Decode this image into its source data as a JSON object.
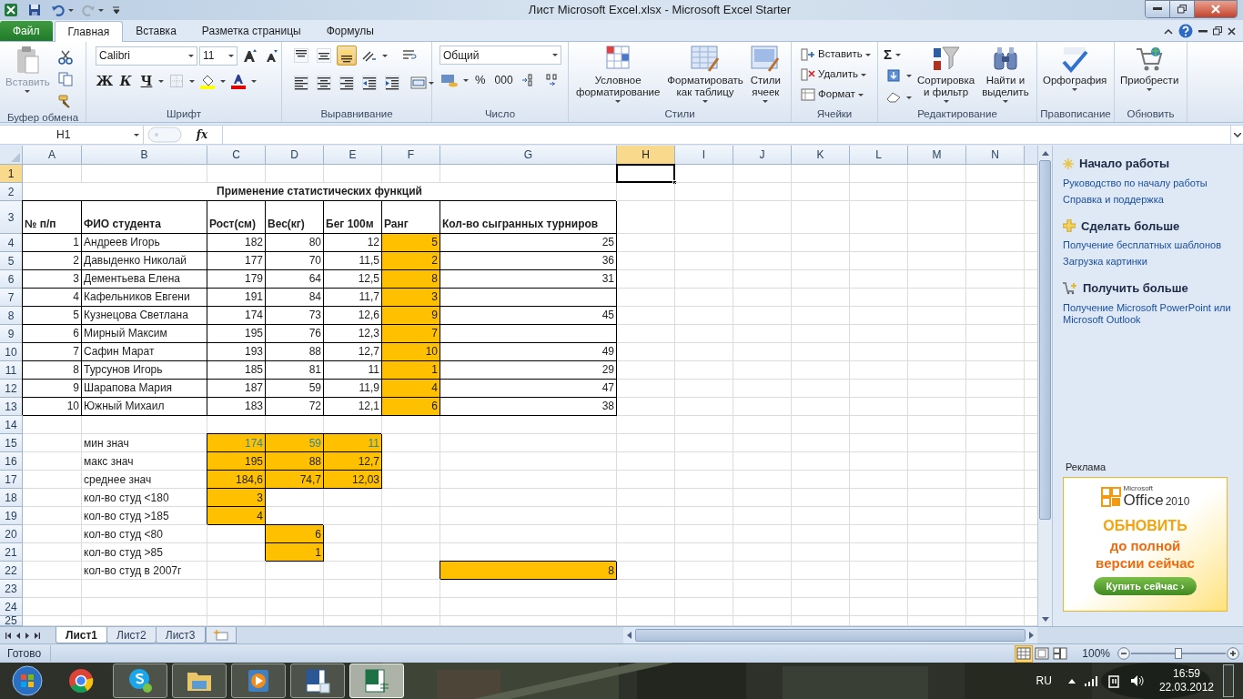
{
  "window": {
    "title": "Лист Microsoft Excel.xlsx - Microsoft Excel Starter"
  },
  "ribbon_tabs": [
    {
      "label": "Файл",
      "kind": "file",
      "selected": false
    },
    {
      "label": "Главная",
      "kind": "tab",
      "selected": true
    },
    {
      "label": "Вставка",
      "kind": "tab",
      "selected": false
    },
    {
      "label": "Разметка страницы",
      "kind": "tab",
      "selected": false
    },
    {
      "label": "Формулы",
      "kind": "tab",
      "selected": false
    }
  ],
  "ribbon": {
    "clipboard": {
      "paste": "Вставить",
      "label": "Буфер обмена"
    },
    "font": {
      "name": "Calibri",
      "size": "11",
      "bold": "Ж",
      "italic": "К",
      "underline": "Ч",
      "label": "Шрифт"
    },
    "alignment": {
      "label": "Выравнивание",
      "vertical": [
        {
          "selected": false
        },
        {
          "selected": false
        },
        {
          "selected": true
        }
      ]
    },
    "number": {
      "format": "Общий",
      "percent": "%",
      "thousands": "000",
      "label": "Число"
    },
    "styles": {
      "conditional": "Условное\nформатирование",
      "as_table": "Форматировать\nкак таблицу",
      "cell_styles": "Стили\nячеек",
      "label": "Стили"
    },
    "cells": {
      "insert": "Вставить",
      "delete": "Удалить",
      "format": "Формат",
      "label": "Ячейки"
    },
    "editing": {
      "sum": "Σ",
      "sort": "Сортировка\nи фильтр",
      "find": "Найти и\nвыделить",
      "label": "Редактирование"
    },
    "proofing": {
      "spelling": "Орфография",
      "label": "Правописание"
    },
    "update": {
      "buy": "Приобрести",
      "label": "Обновить"
    }
  },
  "formula_bar": {
    "name_box": "H1",
    "fx": "fx"
  },
  "sheet": {
    "columns": [
      {
        "label": "A",
        "selected": false
      },
      {
        "label": "B",
        "selected": false
      },
      {
        "label": "C",
        "selected": false
      },
      {
        "label": "D",
        "selected": false
      },
      {
        "label": "E",
        "selected": false
      },
      {
        "label": "F",
        "selected": false
      },
      {
        "label": "G",
        "selected": false
      },
      {
        "label": "H",
        "selected": true
      },
      {
        "label": "I",
        "selected": false
      },
      {
        "label": "J",
        "selected": false
      },
      {
        "label": "K",
        "selected": false
      },
      {
        "label": "L",
        "selected": false
      },
      {
        "label": "M",
        "selected": false
      },
      {
        "label": "N",
        "selected": false
      }
    ],
    "rows": [
      {
        "number": "1",
        "selected": true,
        "cells": {
          "H": {
            "active": true
          }
        }
      },
      {
        "number": "2",
        "selected": false,
        "bold": true,
        "merged_title": "Применение статистических функций"
      },
      {
        "number": "3",
        "selected": false,
        "bold": true,
        "bordered": true,
        "cells": {
          "A": {
            "text": "№ п/п"
          },
          "B": {
            "text": "ФИО студента"
          },
          "C": {
            "text": "Рост(см)"
          },
          "D": {
            "text": "Вес(кг)"
          },
          "E": {
            "text": "Бег 100м"
          },
          "F": {
            "text": "Ранг"
          },
          "G": {
            "text": "Кол-во сыгранных турниров"
          }
        }
      },
      {
        "number": "4",
        "selected": false,
        "bordered": true,
        "cells": {
          "A": {
            "text": "1",
            "numeric": true
          },
          "B": {
            "text": "Андреев Игорь"
          },
          "C": {
            "text": "182",
            "numeric": true
          },
          "D": {
            "text": "80",
            "numeric": true
          },
          "E": {
            "text": "12",
            "numeric": true
          },
          "F": {
            "text": "5",
            "numeric": true,
            "highlighted": true
          },
          "G": {
            "text": "25",
            "numeric": true
          }
        }
      },
      {
        "number": "5",
        "selected": false,
        "bordered": true,
        "cells": {
          "A": {
            "text": "2",
            "numeric": true
          },
          "B": {
            "text": "Давыденко Николай"
          },
          "C": {
            "text": "177",
            "numeric": true
          },
          "D": {
            "text": "70",
            "numeric": true
          },
          "E": {
            "text": "11,5",
            "numeric": true
          },
          "F": {
            "text": "2",
            "numeric": true,
            "highlighted": true
          },
          "G": {
            "text": "36",
            "numeric": true
          }
        }
      },
      {
        "number": "6",
        "selected": false,
        "bordered": true,
        "cells": {
          "A": {
            "text": "3",
            "numeric": true
          },
          "B": {
            "text": "Дементьева Елена"
          },
          "C": {
            "text": "179",
            "numeric": true
          },
          "D": {
            "text": "64",
            "numeric": true
          },
          "E": {
            "text": "12,5",
            "numeric": true
          },
          "F": {
            "text": "8",
            "numeric": true,
            "highlighted": true
          },
          "G": {
            "text": "31",
            "numeric": true
          }
        }
      },
      {
        "number": "7",
        "selected": false,
        "bordered": true,
        "cells": {
          "A": {
            "text": "4",
            "numeric": true
          },
          "B": {
            "text": "Кафельников Евгени"
          },
          "C": {
            "text": "191",
            "numeric": true
          },
          "D": {
            "text": "84",
            "numeric": true
          },
          "E": {
            "text": "11,7",
            "numeric": true
          },
          "F": {
            "text": "3",
            "numeric": true,
            "highlighted": true
          }
        }
      },
      {
        "number": "8",
        "selected": false,
        "bordered": true,
        "cells": {
          "A": {
            "text": "5",
            "numeric": true
          },
          "B": {
            "text": "Кузнецова Светлана"
          },
          "C": {
            "text": "174",
            "numeric": true
          },
          "D": {
            "text": "73",
            "numeric": true
          },
          "E": {
            "text": "12,6",
            "numeric": true
          },
          "F": {
            "text": "9",
            "numeric": true,
            "highlighted": true
          },
          "G": {
            "text": "45",
            "numeric": true
          }
        }
      },
      {
        "number": "9",
        "selected": false,
        "bordered": true,
        "cells": {
          "A": {
            "text": "6",
            "numeric": true
          },
          "B": {
            "text": "Мирный Максим"
          },
          "C": {
            "text": "195",
            "numeric": true
          },
          "D": {
            "text": "76",
            "numeric": true
          },
          "E": {
            "text": "12,3",
            "numeric": true
          },
          "F": {
            "text": "7",
            "numeric": true,
            "highlighted": true
          }
        }
      },
      {
        "number": "10",
        "selected": false,
        "bordered": true,
        "cells": {
          "A": {
            "text": "7",
            "numeric": true
          },
          "B": {
            "text": "Сафин Марат"
          },
          "C": {
            "text": "193",
            "numeric": true
          },
          "D": {
            "text": "88",
            "numeric": true
          },
          "E": {
            "text": "12,7",
            "numeric": true
          },
          "F": {
            "text": "10",
            "numeric": true,
            "highlighted": true
          },
          "G": {
            "text": "49",
            "numeric": true
          }
        }
      },
      {
        "number": "11",
        "selected": false,
        "bordered": true,
        "cells": {
          "A": {
            "text": "8",
            "numeric": true
          },
          "B": {
            "text": "Турсунов Игорь"
          },
          "C": {
            "text": "185",
            "numeric": true
          },
          "D": {
            "text": "81",
            "numeric": true
          },
          "E": {
            "text": "11",
            "numeric": true
          },
          "F": {
            "text": "1",
            "numeric": true,
            "highlighted": true
          },
          "G": {
            "text": "29",
            "numeric": true
          }
        }
      },
      {
        "number": "12",
        "selected": false,
        "bordered": true,
        "cells": {
          "A": {
            "text": "9",
            "numeric": true
          },
          "B": {
            "text": "Шарапова Мария"
          },
          "C": {
            "text": "187",
            "numeric": true
          },
          "D": {
            "text": "59",
            "numeric": true
          },
          "E": {
            "text": "11,9",
            "numeric": true
          },
          "F": {
            "text": "4",
            "numeric": true,
            "highlighted": true
          },
          "G": {
            "text": "47",
            "numeric": true
          }
        }
      },
      {
        "number": "13",
        "selected": false,
        "bordered": true,
        "cells": {
          "A": {
            "text": "10",
            "numeric": true
          },
          "B": {
            "text": "Южный Михаил"
          },
          "C": {
            "text": "183",
            "numeric": true
          },
          "D": {
            "text": "72",
            "numeric": true
          },
          "E": {
            "text": "12,1",
            "numeric": true
          },
          "F": {
            "text": "6",
            "numeric": true,
            "highlighted": true
          },
          "G": {
            "text": "38",
            "numeric": true
          }
        }
      },
      {
        "number": "14",
        "selected": false
      },
      {
        "number": "15",
        "selected": false,
        "cells": {
          "B": {
            "text": "мин знач"
          },
          "C": {
            "text": "174",
            "numeric": true,
            "highlighted": true,
            "accent": true
          },
          "D": {
            "text": "59",
            "numeric": true,
            "highlighted": true,
            "accent": true
          },
          "E": {
            "text": "11",
            "numeric": true,
            "highlighted": true,
            "accent": true
          }
        }
      },
      {
        "number": "16",
        "selected": false,
        "cells": {
          "B": {
            "text": "макс знач"
          },
          "C": {
            "text": "195",
            "numeric": true,
            "highlighted": true
          },
          "D": {
            "text": "88",
            "numeric": true,
            "highlighted": true
          },
          "E": {
            "text": "12,7",
            "numeric": true,
            "highlighted": true
          }
        }
      },
      {
        "number": "17",
        "selected": false,
        "cells": {
          "B": {
            "text": "среднее знач"
          },
          "C": {
            "text": "184,6",
            "numeric": true,
            "highlighted": true
          },
          "D": {
            "text": "74,7",
            "numeric": true,
            "highlighted": true
          },
          "E": {
            "text": "12,03",
            "numeric": true,
            "highlighted": true
          }
        }
      },
      {
        "number": "18",
        "selected": false,
        "cells": {
          "B": {
            "text": "кол-во студ <180"
          },
          "C": {
            "text": "3",
            "numeric": true,
            "highlighted": true
          }
        }
      },
      {
        "number": "19",
        "selected": false,
        "cells": {
          "B": {
            "text": "кол-во студ >185"
          },
          "C": {
            "text": "4",
            "numeric": true,
            "highlighted": true
          }
        }
      },
      {
        "number": "20",
        "selected": false,
        "cells": {
          "B": {
            "text": "кол-во студ <80"
          },
          "D": {
            "text": "6",
            "numeric": true,
            "highlighted": true
          }
        }
      },
      {
        "number": "21",
        "selected": false,
        "cells": {
          "B": {
            "text": "кол-во студ >85"
          },
          "D": {
            "text": "1",
            "numeric": true,
            "highlighted": true
          }
        }
      },
      {
        "number": "22",
        "selected": false,
        "cells": {
          "B": {
            "text": "кол-во студ в 2007г"
          },
          "G": {
            "text": "8",
            "numeric": true,
            "highlighted": true
          }
        }
      },
      {
        "number": "23",
        "selected": false
      },
      {
        "number": "24",
        "selected": false
      },
      {
        "number": "25",
        "selected": false
      }
    ]
  },
  "sheet_tabs": [
    {
      "label": "Лист1",
      "selected": true
    },
    {
      "label": "Лист2",
      "selected": false
    },
    {
      "label": "Лист3",
      "selected": false
    }
  ],
  "status_bar": {
    "status": "Готово",
    "views": [
      {
        "selected": true
      },
      {
        "selected": false
      },
      {
        "selected": false
      }
    ],
    "zoom": "100%",
    "zoom_slider": {
      "level": 0.5
    }
  },
  "task_pane": {
    "sections": [
      {
        "kind": "start",
        "heading": "Начало работы",
        "links": [
          "Руководство по началу работы",
          "Справка и поддержка"
        ]
      },
      {
        "kind": "more",
        "heading": "Сделать больше",
        "links": [
          "Получение бесплатных шаблонов",
          "Загрузка картинки"
        ]
      },
      {
        "kind": "get",
        "heading": "Получить больше",
        "links": [
          "Получение Microsoft PowerPoint или Microsoft Outlook"
        ]
      }
    ],
    "ad": {
      "label": "Реклама",
      "brand_small": "Microsoft",
      "brand": "Office",
      "year": "2010",
      "headline": "ОБНОВИТЬ",
      "subline": "до полной\nверсии сейчас",
      "button": "Купить сейчас ›"
    }
  },
  "taskbar": {
    "apps": [
      {
        "kind": "browser",
        "running": false,
        "selected": false
      },
      {
        "kind": "chat",
        "running": true,
        "selected": false
      },
      {
        "kind": "folder",
        "running": true,
        "selected": false
      },
      {
        "kind": "player",
        "running": true,
        "selected": false
      },
      {
        "kind": "writer",
        "running": true,
        "selected": false
      },
      {
        "kind": "sheet",
        "running": true,
        "selected": true
      }
    ],
    "language": "RU",
    "time": "16:59",
    "date": "22.03.2012"
  }
}
